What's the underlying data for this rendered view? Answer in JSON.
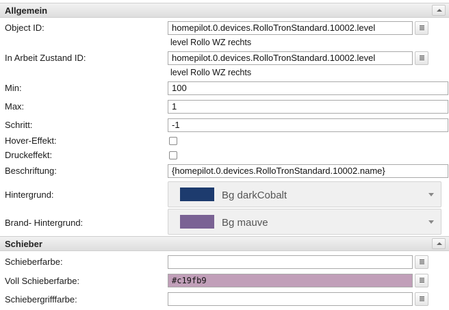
{
  "sections": {
    "allgemein": {
      "title": "Allgemein"
    },
    "schieber": {
      "title": "Schieber"
    }
  },
  "fields": {
    "object_id": {
      "label": "Object ID:",
      "value": "homepilot.0.devices.RolloTronStandard.10002.level",
      "hint": "level Rollo WZ rechts"
    },
    "in_arbeit": {
      "label": "In Arbeit Zustand ID:",
      "value": "homepilot.0.devices.RolloTronStandard.10002.level",
      "hint": "level Rollo WZ rechts"
    },
    "min": {
      "label": "Min:",
      "value": "100"
    },
    "max": {
      "label": "Max:",
      "value": "1"
    },
    "schritt": {
      "label": "Schritt:",
      "value": "-1"
    },
    "hover": {
      "label": "Hover-Effekt:",
      "checked": false
    },
    "druck": {
      "label": "Druckeffekt:",
      "checked": false
    },
    "beschriftung": {
      "label": "Beschriftung:",
      "value": "{homepilot.0.devices.RolloTronStandard.10002.name}"
    },
    "hintergrund": {
      "label": "Hintergrund:",
      "value": "Bg darkCobalt",
      "swatch_color": "#1d3b6e"
    },
    "brand_hintergrund": {
      "label": "Brand- Hintergrund:",
      "value": "Bg mauve",
      "swatch_color": "#7a6294"
    },
    "schieberfarbe": {
      "label": "Schieberfarbe:",
      "value": ""
    },
    "voll_schieberfarbe": {
      "label": "Voll Schieberfarbe:",
      "value": "#c19fb9",
      "bg_color": "#c19fb9"
    },
    "schiebergrifffarbe": {
      "label": "Schiebergrifffarbe:",
      "value": ""
    }
  },
  "icons": {
    "picker": "list-icon",
    "collapse": "chevron-up-icon",
    "dropdown": "caret-down-icon"
  }
}
